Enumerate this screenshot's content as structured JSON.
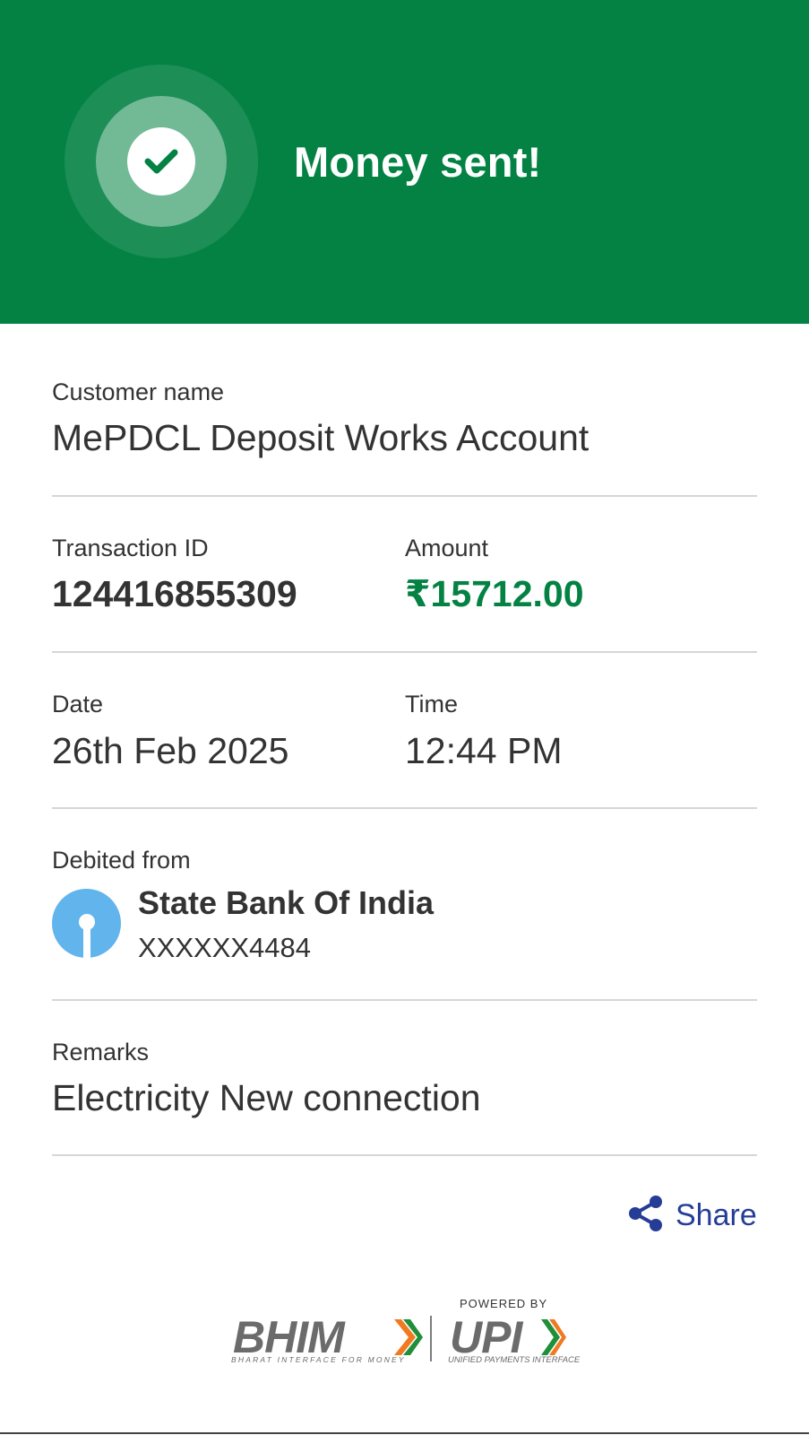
{
  "header": {
    "title": "Money sent!",
    "icon": "check-icon",
    "background_color": "#038243"
  },
  "customer": {
    "label": "Customer name",
    "value": "MePDCL Deposit Works Account"
  },
  "transaction": {
    "id_label": "Transaction ID",
    "id_value": "124416855309",
    "amount_label": "Amount",
    "amount_value": "₹15712.00",
    "amount_color": "#038243"
  },
  "datetime": {
    "date_label": "Date",
    "date_value": "26th Feb 2025",
    "time_label": "Time",
    "time_value": "12:44 PM"
  },
  "debit": {
    "label": "Debited from",
    "bank_icon": "sbi-logo-icon",
    "bank_name": "State Bank Of India",
    "account": "XXXXXX4484"
  },
  "remarks": {
    "label": "Remarks",
    "value": "Electricity New connection"
  },
  "actions": {
    "share_label": "Share",
    "share_icon": "share-icon",
    "share_color": "#253d96"
  },
  "footer": {
    "powered_by": "POWERED BY",
    "bhim": "BHIM",
    "bhim_tagline": "BHARAT INTERFACE FOR MONEY",
    "upi": "UPI",
    "upi_tagline": "UNIFIED PAYMENTS INTERFACE"
  }
}
